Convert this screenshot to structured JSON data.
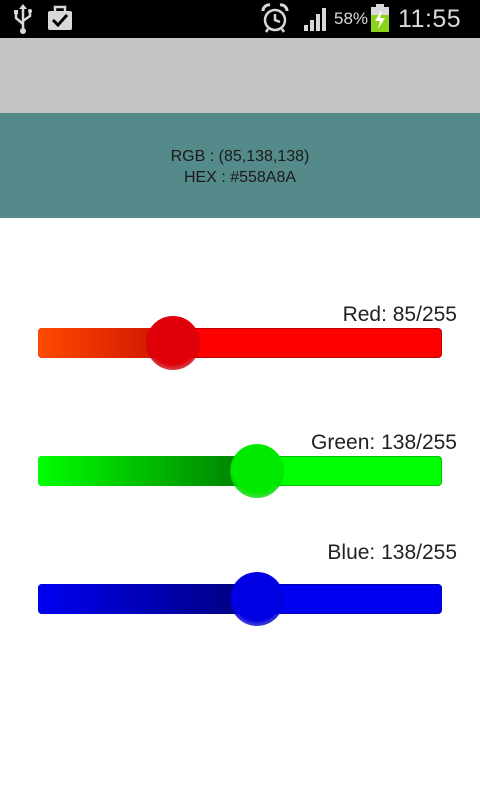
{
  "status_bar": {
    "battery_percent": "58%",
    "time": "11:55",
    "icons": [
      "usb-icon",
      "task-check-icon",
      "alarm-icon",
      "signal-icon",
      "battery-charging-icon"
    ]
  },
  "color_preview": {
    "rgb_text": "RGB : (85,138,138)",
    "hex_text": "HEX : #558A8A",
    "color": "#558A8A"
  },
  "sliders": [
    {
      "label": "Red: 85/255",
      "value": 85,
      "max": 255,
      "track_color": "#ff0000",
      "fill_start": "#ff4a00",
      "fill_end": "#cc1000",
      "thumb_color": "#e0000a"
    },
    {
      "label": "Green: 138/255",
      "value": 138,
      "max": 255,
      "track_color": "#00ff00",
      "fill_start": "#00ff00",
      "fill_end": "#007800",
      "thumb_color": "#00ea00"
    },
    {
      "label": "Blue: 138/255",
      "value": 138,
      "max": 255,
      "track_color": "#0000f2",
      "fill_start": "#0000f0",
      "fill_end": "#00007a",
      "thumb_color": "#0000e2"
    }
  ]
}
